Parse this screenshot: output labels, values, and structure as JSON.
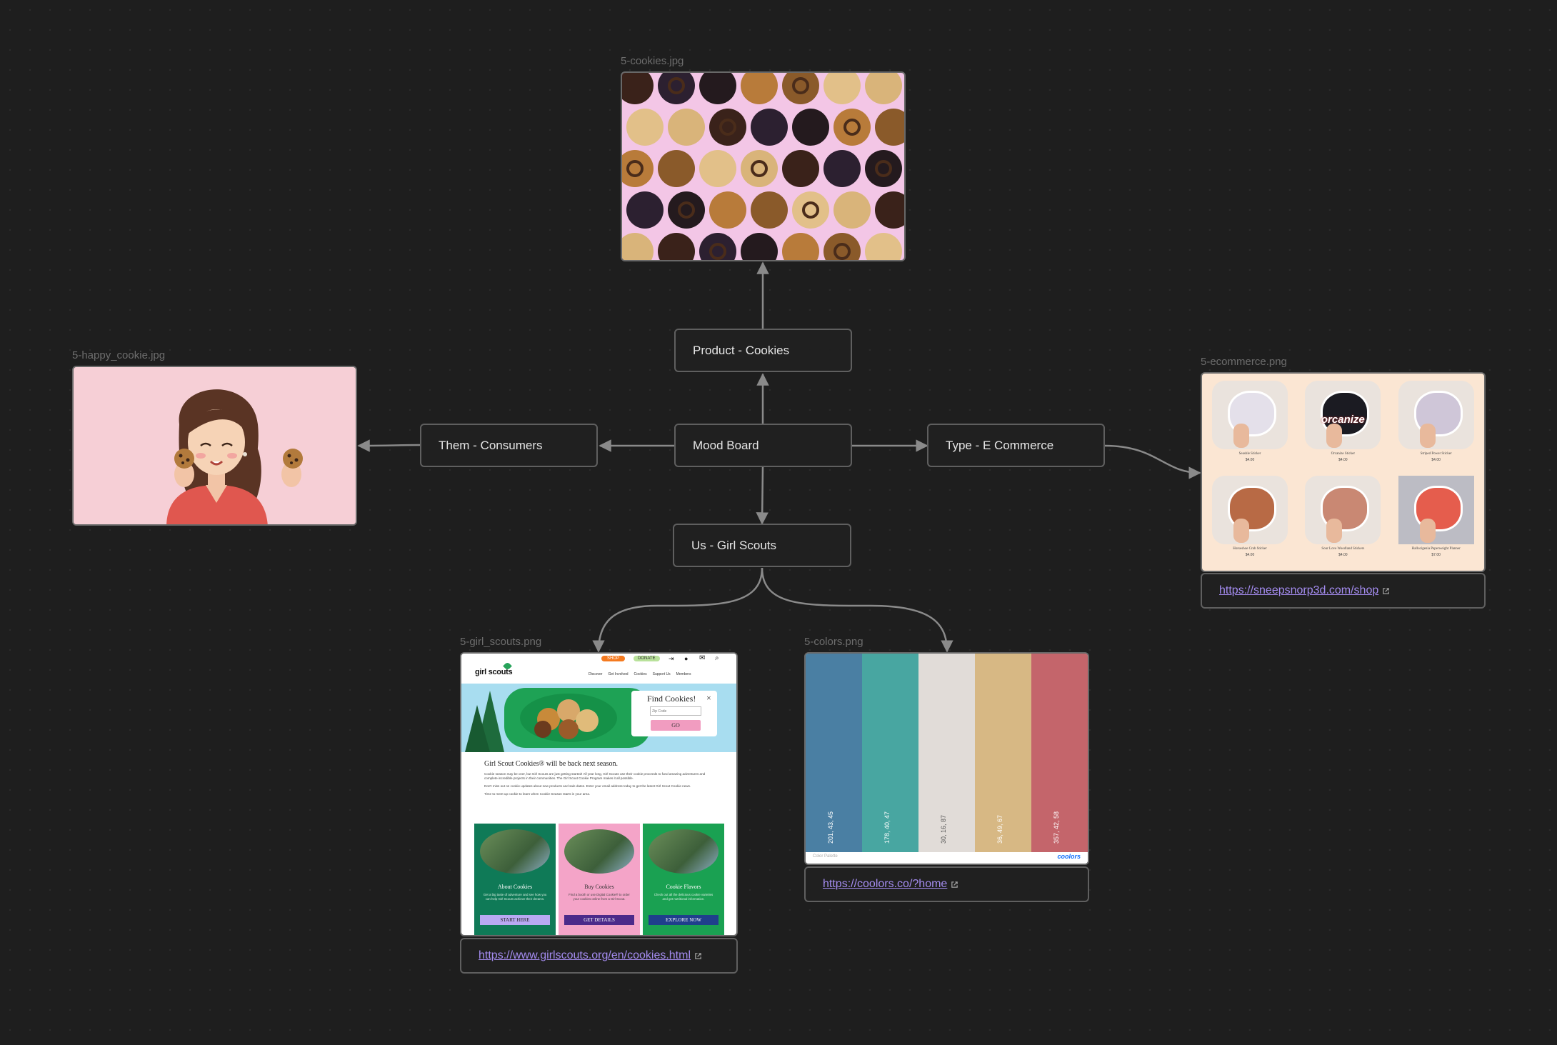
{
  "canvas": {
    "central": "Mood Board",
    "product": "Product - Cookies",
    "them": "Them - Consumers",
    "type": "Type - E Commerce",
    "us": "Us - Girl Scouts"
  },
  "files": {
    "cookies": {
      "label": "5-cookies.jpg"
    },
    "happy_cookie": {
      "label": "5-happy_cookie.jpg"
    },
    "ecommerce": {
      "label": "5-ecommerce.png",
      "link": "https://sneepsnorp3d.com/shop",
      "products": [
        {
          "name": "Seashle Sticker",
          "price": "$4.00",
          "word": ""
        },
        {
          "name": "Orcanize Sticker",
          "price": "$4.00",
          "word": "orcanize"
        },
        {
          "name": "Striped Power Sticker",
          "price": "$4.00",
          "word": ""
        },
        {
          "name": "Horseshoe Crab Sticker",
          "price": "$4.00",
          "word": ""
        },
        {
          "name": "Sour Love Woodland Stickers",
          "price": "$4.00",
          "word": ""
        },
        {
          "name": "Hallucigenia Paperweight Planner",
          "price": "$7.00",
          "word": ""
        }
      ]
    },
    "girl_scouts": {
      "label": "5-girl_scouts.png",
      "link": "https://www.girlscouts.org/en/cookies.html",
      "shop_btn": "SHOP",
      "donate_btn": "DONATE",
      "logo": "girl scouts",
      "nav": [
        "Discover",
        "Get Involved",
        "Cookies",
        "Support Us",
        "Members"
      ],
      "find_title": "Find Cookies!",
      "find_close": "×",
      "zip_placeholder": "Zip Code",
      "go": "GO",
      "headline": "Girl Scout Cookies® will be back next season.",
      "paragraphs": [
        "Cookie season may be over, but Girl Scouts are just getting started! All year long, Girl Scouts use their cookie proceeds to fund amazing adventures and complete incredible projects in their communities. The Girl Scout Cookie Program makes it all possible.",
        "Don't miss out on cookie updates about new products and sale dates. Enter your email address today to get the latest Girl Scout Cookie news.",
        "Time to meet up cookie to learn when Cookie Season starts in your area."
      ],
      "cards": [
        {
          "title": "About Cookies",
          "text": "Get a big taste of adventure and see how you can help Girl Scouts achieve their dreams.",
          "button": "START HERE"
        },
        {
          "title": "Buy Cookies",
          "text": "Find a booth or use Digital Cookie® to order your cookies online from a Girl Scout.",
          "button": "GET DETAILS"
        },
        {
          "title": "Cookie Flavors",
          "text": "Check out all the delicious cookie varieties and get nutritional information.",
          "button": "EXPLORE NOW"
        }
      ]
    },
    "colors": {
      "label": "5-colors.png",
      "link": "https://coolors.co/?home",
      "footer_left": "Color Palette",
      "brand": "coolors",
      "swatches": [
        {
          "hex": "#4a7fa3",
          "text": "201, 43, 45"
        },
        {
          "hex": "#48a6a1",
          "text": "178, 40, 47"
        },
        {
          "hex": "#e1dcd8",
          "text": "30, 16, 87"
        },
        {
          "hex": "#d7b884",
          "text": "36, 49, 67"
        },
        {
          "hex": "#c4656b",
          "text": "357, 42, 58"
        }
      ]
    }
  },
  "colors": {
    "background": "#1e1e1e",
    "node_border": "#5f5f5f",
    "edge": "#8a8a8a",
    "link": "#a48cf0",
    "label": "#6d6d6d"
  }
}
